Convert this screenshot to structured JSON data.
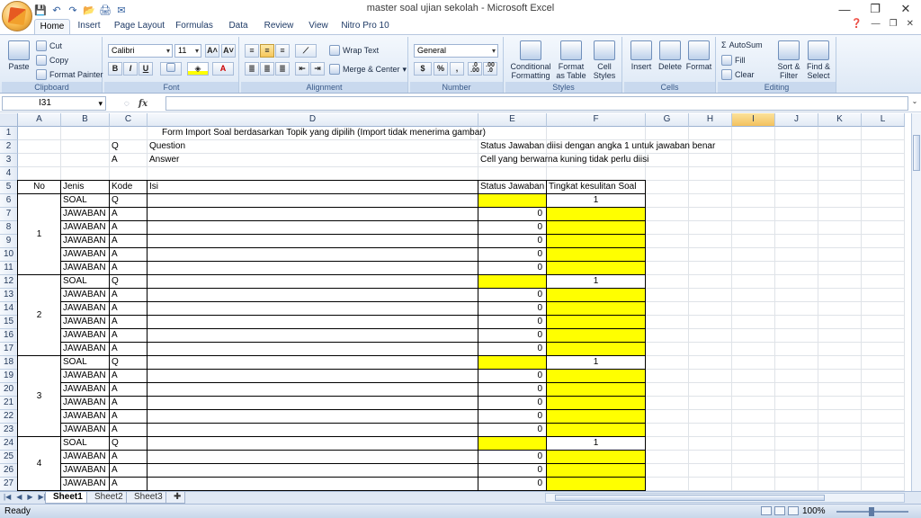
{
  "window": {
    "title": "master soal ujian sekolah - Microsoft Excel",
    "minimize": "—",
    "restore": "❐",
    "close": "✕"
  },
  "qat": [
    "💾",
    "↶",
    "↷",
    "📂",
    "🖨",
    "✉"
  ],
  "tabs": [
    "Home",
    "Insert",
    "Page Layout",
    "Formulas",
    "Data",
    "Review",
    "View",
    "Nitro Pro 10"
  ],
  "ribbon": {
    "clipboard": {
      "label": "Clipboard",
      "paste": "Paste",
      "cut": "Cut",
      "copy": "Copy",
      "format_painter": "Format Painter"
    },
    "font": {
      "label": "Font",
      "name": "Calibri",
      "size": "11",
      "grow": "A˄",
      "shrink": "A˅",
      "bold": "B",
      "italic": "I",
      "underline": "U"
    },
    "alignment": {
      "label": "Alignment",
      "wrap": "Wrap Text",
      "merge": "Merge & Center"
    },
    "number": {
      "label": "Number",
      "format": "General",
      "currency": "$",
      "percent": "%",
      "comma": ",",
      "inc_dec": ".0\n.00",
      "dec_dec": ".00\n.0"
    },
    "styles": {
      "label": "Styles",
      "conditional": "Conditional\nFormatting",
      "format_table": "Format\nas Table",
      "cell_styles": "Cell\nStyles"
    },
    "cells": {
      "label": "Cells",
      "insert": "Insert",
      "delete": "Delete",
      "format": "Format"
    },
    "editing": {
      "label": "Editing",
      "autosum": "AutoSum",
      "fill": "Fill",
      "clear": "Clear",
      "sort": "Sort &\nFilter",
      "find": "Find &\nSelect"
    }
  },
  "formula_bar": {
    "name_box": "I31",
    "fx": "fx",
    "value": ""
  },
  "columns": [
    "A",
    "B",
    "C",
    "D",
    "E",
    "F",
    "G",
    "H",
    "I",
    "J",
    "K",
    "L"
  ],
  "selected_column": "I",
  "rows": [
    "1",
    "2",
    "3",
    "4",
    "5",
    "6",
    "7",
    "8",
    "9",
    "10",
    "11",
    "12",
    "13",
    "14",
    "15",
    "16",
    "17",
    "18",
    "19",
    "20",
    "21",
    "22",
    "23",
    "24",
    "25",
    "26",
    "27"
  ],
  "header_text": {
    "title": "Form Import Soal berdasarkan Topik yang dipilih (Import tidak menerima gambar)",
    "q": "Q",
    "question": "Question",
    "a": "A",
    "answer": "Answer",
    "note1": "Status Jawaban diisi dengan angka 1 untuk jawaban benar",
    "note2": "Cell yang berwarna kuning tidak perlu diisi"
  },
  "table_header": {
    "no": "No",
    "jenis": "Jenis",
    "kode": "Kode",
    "isi": "Isi",
    "status": "Status Jawaban",
    "tingkat": "Tingkat kesulitan Soal"
  },
  "groups": [
    {
      "no": "1",
      "rows": [
        {
          "jenis": "SOAL",
          "kode": "Q",
          "status": "",
          "tingkat": "1"
        },
        {
          "jenis": "JAWABAN",
          "kode": "A",
          "status": "0",
          "tingkat": ""
        },
        {
          "jenis": "JAWABAN",
          "kode": "A",
          "status": "0",
          "tingkat": ""
        },
        {
          "jenis": "JAWABAN",
          "kode": "A",
          "status": "0",
          "tingkat": ""
        },
        {
          "jenis": "JAWABAN",
          "kode": "A",
          "status": "0",
          "tingkat": ""
        },
        {
          "jenis": "JAWABAN",
          "kode": "A",
          "status": "0",
          "tingkat": ""
        }
      ]
    },
    {
      "no": "2",
      "rows": [
        {
          "jenis": "SOAL",
          "kode": "Q",
          "status": "",
          "tingkat": "1"
        },
        {
          "jenis": "JAWABAN",
          "kode": "A",
          "status": "0",
          "tingkat": ""
        },
        {
          "jenis": "JAWABAN",
          "kode": "A",
          "status": "0",
          "tingkat": ""
        },
        {
          "jenis": "JAWABAN",
          "kode": "A",
          "status": "0",
          "tingkat": ""
        },
        {
          "jenis": "JAWABAN",
          "kode": "A",
          "status": "0",
          "tingkat": ""
        },
        {
          "jenis": "JAWABAN",
          "kode": "A",
          "status": "0",
          "tingkat": ""
        }
      ]
    },
    {
      "no": "3",
      "rows": [
        {
          "jenis": "SOAL",
          "kode": "Q",
          "status": "",
          "tingkat": "1"
        },
        {
          "jenis": "JAWABAN",
          "kode": "A",
          "status": "0",
          "tingkat": ""
        },
        {
          "jenis": "JAWABAN",
          "kode": "A",
          "status": "0",
          "tingkat": ""
        },
        {
          "jenis": "JAWABAN",
          "kode": "A",
          "status": "0",
          "tingkat": ""
        },
        {
          "jenis": "JAWABAN",
          "kode": "A",
          "status": "0",
          "tingkat": ""
        },
        {
          "jenis": "JAWABAN",
          "kode": "A",
          "status": "0",
          "tingkat": ""
        }
      ]
    },
    {
      "no": "4",
      "rows": [
        {
          "jenis": "SOAL",
          "kode": "Q",
          "status": "",
          "tingkat": "1"
        },
        {
          "jenis": "JAWABAN",
          "kode": "A",
          "status": "0",
          "tingkat": ""
        },
        {
          "jenis": "JAWABAN",
          "kode": "A",
          "status": "0",
          "tingkat": ""
        },
        {
          "jenis": "JAWABAN",
          "kode": "A",
          "status": "0",
          "tingkat": ""
        }
      ]
    }
  ],
  "sheets": [
    "Sheet1",
    "Sheet2",
    "Sheet3"
  ],
  "active_sheet": "Sheet1",
  "status": {
    "text": "Ready",
    "zoom": "100%"
  },
  "colors": {
    "yellow": "#ffff00",
    "selected_header": "#f3c15e"
  }
}
